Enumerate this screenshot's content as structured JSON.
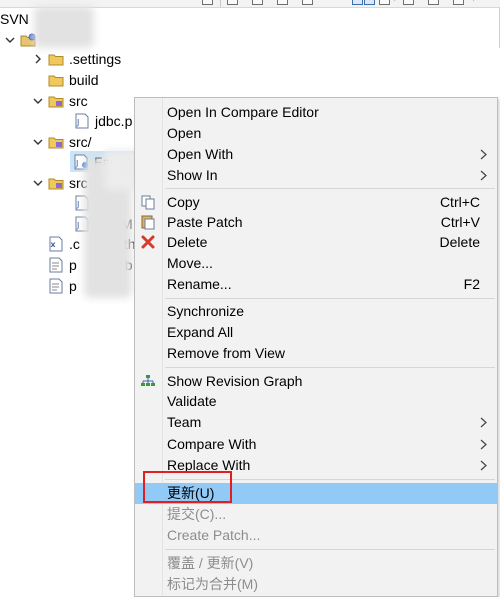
{
  "explorer": {
    "root_label": "SVN",
    "tree": [
      {
        "id": "settings",
        "label": ".settings",
        "twisty": "collapsed",
        "icon": "folder-icon"
      },
      {
        "id": "build",
        "label": "build",
        "twisty": "none",
        "icon": "folder-icon"
      },
      {
        "id": "src1",
        "label": "src",
        "twisty": "expanded",
        "icon": "source-folder-icon"
      },
      {
        "id": "jdbc",
        "label": "jdbc.p",
        "twisty": "none",
        "icon": "java-file-icon"
      },
      {
        "id": "src2",
        "label": "src/",
        "twisty": "expanded",
        "icon": "source-folder-icon"
      },
      {
        "id": "fastq",
        "label": "FastQ",
        "twisty": "none",
        "icon": "java-file-icon"
      },
      {
        "id": "src3",
        "label": "src",
        "twisty": "expanded",
        "icon": "source-folder-icon"
      },
      {
        "id": "file_o",
        "label": "o",
        "twisty": "none",
        "icon": "java-file-icon"
      },
      {
        "id": "file_m",
        "label": "M",
        "twisty": "none",
        "icon": "java-file-icon"
      },
      {
        "id": "classpath",
        "label": ".c",
        "label_tail": "th",
        "twisty": "none",
        "icon": "xml-file-icon"
      },
      {
        "id": "file_p1",
        "label": "p",
        "label_tail": "b",
        "twisty": "none",
        "icon": "text-file-icon"
      },
      {
        "id": "file_p2",
        "label": "p",
        "label_tail": "-",
        "twisty": "none",
        "icon": "text-file-icon"
      }
    ]
  },
  "context_menu": {
    "items": [
      {
        "id": "open-compare",
        "label": "Open In Compare Editor"
      },
      {
        "id": "open",
        "label": "Open"
      },
      {
        "id": "open-with",
        "label": "Open With",
        "submenu": true
      },
      {
        "id": "show-in",
        "label": "Show In",
        "submenu": true
      },
      {
        "id": "copy",
        "label": "Copy",
        "shortcut": "Ctrl+C",
        "icon": "copy-icon"
      },
      {
        "id": "paste-patch",
        "label": "Paste Patch",
        "shortcut": "Ctrl+V",
        "icon": "paste-icon"
      },
      {
        "id": "delete",
        "label": "Delete",
        "shortcut": "Delete",
        "icon": "delete-icon"
      },
      {
        "id": "move",
        "label": "Move..."
      },
      {
        "id": "rename",
        "label": "Rename...",
        "shortcut": "F2"
      },
      {
        "id": "synchronize",
        "label": "Synchronize"
      },
      {
        "id": "expand-all",
        "label": "Expand All"
      },
      {
        "id": "remove-from-view",
        "label": "Remove from View"
      },
      {
        "id": "show-revision-graph",
        "label": "Show Revision Graph",
        "icon": "revision-graph-icon"
      },
      {
        "id": "validate",
        "label": "Validate"
      },
      {
        "id": "team",
        "label": "Team",
        "submenu": true
      },
      {
        "id": "compare-with",
        "label": "Compare With",
        "submenu": true
      },
      {
        "id": "replace-with",
        "label": "Replace With",
        "submenu": true
      },
      {
        "id": "update",
        "label": "更新(U)",
        "highlighted": true
      },
      {
        "id": "commit",
        "label": "提交(C)...",
        "disabled": true
      },
      {
        "id": "create-patch",
        "label": "Create Patch...",
        "disabled": true
      },
      {
        "id": "override-update",
        "label": "覆盖 / 更新(V)",
        "disabled": true
      },
      {
        "id": "mark-merged",
        "label": "标记为合并(M)",
        "disabled": true
      }
    ]
  },
  "colors": {
    "menu_background": "#f2f2f2",
    "highlight": "#91c9f7",
    "disabled_text": "#8d8d8d",
    "annotation": "#e02020",
    "selection": "#cce4f7"
  }
}
